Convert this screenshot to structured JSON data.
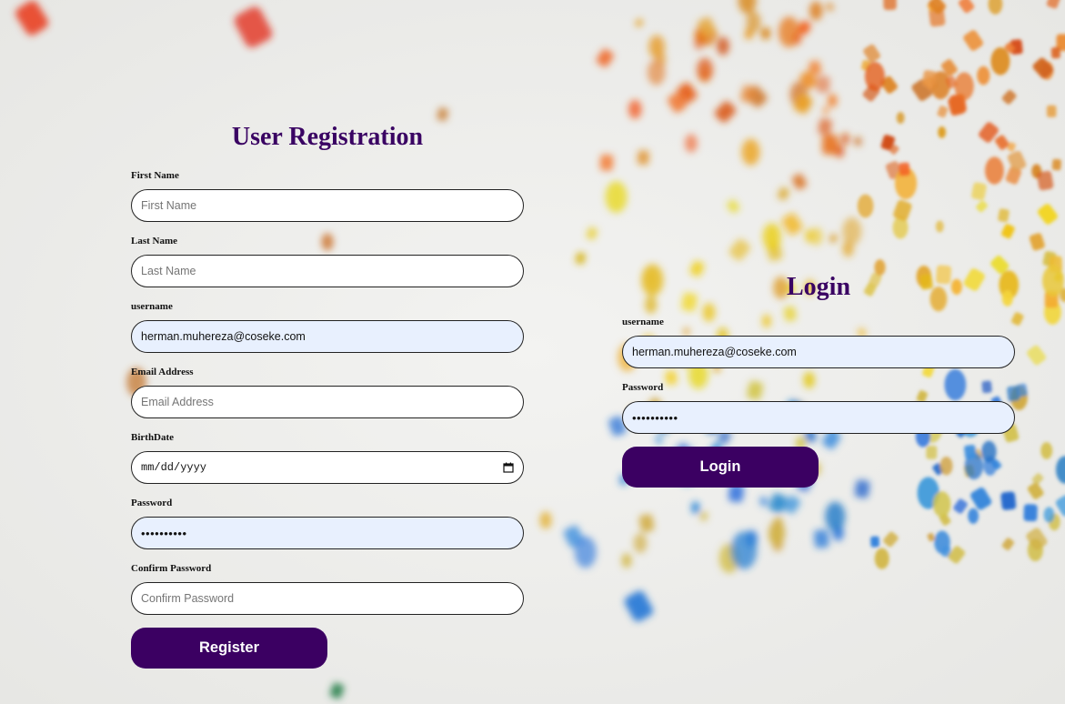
{
  "registration": {
    "title": "User Registration",
    "first_name": {
      "label": "First Name",
      "placeholder": "First Name",
      "value": ""
    },
    "last_name": {
      "label": "Last Name",
      "placeholder": "Last Name",
      "value": ""
    },
    "username": {
      "label": "username",
      "value": "herman.muhereza@coseke.com"
    },
    "email": {
      "label": "Email Address",
      "placeholder": "Email Address",
      "value": ""
    },
    "birthdate": {
      "label": "BirthDate",
      "value": "mm/dd/yyyy"
    },
    "password": {
      "label": "Password",
      "value": "••••••••••"
    },
    "confirm_password": {
      "label": "Confirm Password",
      "placeholder": "Confirm Password",
      "value": ""
    },
    "submit_label": "Register"
  },
  "login": {
    "title": "Login",
    "username": {
      "label": "username",
      "value": "herman.muhereza@coseke.com"
    },
    "password": {
      "label": "Password",
      "value": "••••••••••"
    },
    "submit_label": "Login"
  },
  "colors": {
    "accent": "#3b0062",
    "title": "#3a0463",
    "autofill_bg": "#e8f0fe",
    "input_bg": "#ffffff"
  }
}
